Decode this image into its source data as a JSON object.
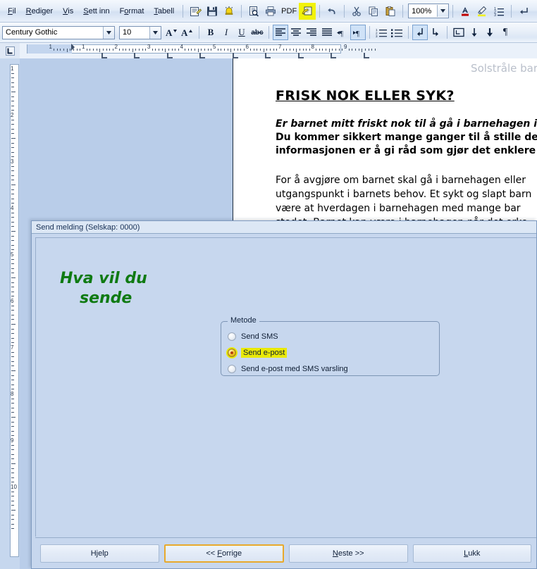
{
  "menubar": {
    "items": [
      {
        "label": "Fil",
        "accel": "F"
      },
      {
        "label": "Rediger",
        "accel": "R"
      },
      {
        "label": "Vis",
        "accel": "V"
      },
      {
        "label": "Sett inn",
        "accel": "S"
      },
      {
        "label": "Format",
        "accel": "o"
      },
      {
        "label": "Tabell",
        "accel": "T"
      }
    ],
    "pdf_label": "PDF",
    "zoom_value": "100%",
    "icons": [
      "properties-icon",
      "save-icon",
      "alert-icon",
      "print-preview-icon",
      "print-icon",
      "send-message-icon",
      "undo-icon",
      "cut-icon",
      "copy-icon",
      "paste-icon",
      "font-color-icon",
      "highlight-color-icon",
      "numbered-list-icon",
      "insert-break-icon"
    ],
    "highlighted_icon": "send-message-icon"
  },
  "formatbar": {
    "font_name": "Century Gothic",
    "font_size": "10",
    "buttons": [
      "grow-font-icon",
      "shrink-font-icon",
      "bold-icon",
      "italic-icon",
      "underline-icon",
      "strikethrough-icon",
      "align-left-icon",
      "align-center-icon",
      "align-right-icon",
      "align-justify-icon",
      "rtl-direction-icon",
      "ltr-direction-icon",
      "numbered-list-icon",
      "bulleted-list-icon",
      "line-down-left-icon",
      "line-down-right-icon",
      "insert-field-icon",
      "move-down-icon",
      "move-down-2-icon",
      "pilcrow-icon"
    ],
    "active_buttons": [
      "align-left-icon",
      "ltr-direction-icon",
      "line-down-left-icon"
    ],
    "bold_label": "B",
    "italic_label": "I",
    "underline_label": "U",
    "strike_label": "abc"
  },
  "ruler": {
    "horizontal_numbers": [
      "1",
      "1",
      "2",
      "3",
      "4",
      "5",
      "6",
      "7",
      "8",
      "9"
    ],
    "vertical_numbers": [
      "1",
      "2",
      "3",
      "4",
      "5",
      "6",
      "7",
      "8",
      "9",
      "10"
    ]
  },
  "document": {
    "header": "Solstråle barneh",
    "title": "FRISK NOK ELLER SYK?",
    "lead_lines": [
      "Er barnet mitt friskt nok til å gå i barnehagen i dag?",
      "Du kommer sikkert mange ganger til å stille deg sel",
      "informasjonen er å gi råd som gjør det enklere for d"
    ],
    "body_lines": [
      "For å avgjøre om barnet skal gå i barnehagen eller",
      "utgangspunkt i barnets behov.  Et sykt og slapt barn",
      "være at hverdagen i barnehagen med mange bar",
      "stedet. Barnet kan være i barnehagen når det erke"
    ]
  },
  "dialog": {
    "title": "Send melding (Selskap: 0000)",
    "heading_line1": "Hva vil du",
    "heading_line2": "sende",
    "heading_color": "#0f7a12",
    "highlight_color": "#e9e907",
    "group": {
      "legend": "Metode",
      "options": [
        {
          "label": "Send SMS",
          "checked": false,
          "highlighted": false
        },
        {
          "label": "Send e-post",
          "checked": true,
          "highlighted": true
        },
        {
          "label": "Send e-post med SMS varsling",
          "checked": false,
          "highlighted": false
        }
      ]
    },
    "buttons": [
      {
        "label": "Hjelp",
        "accel": "j",
        "focused": false
      },
      {
        "label": "<< Forrige",
        "accel": "F",
        "focused": true
      },
      {
        "label": "Neste >>",
        "accel": "N",
        "focused": false
      },
      {
        "label": "Lukk",
        "accel": "L",
        "focused": false
      }
    ]
  }
}
